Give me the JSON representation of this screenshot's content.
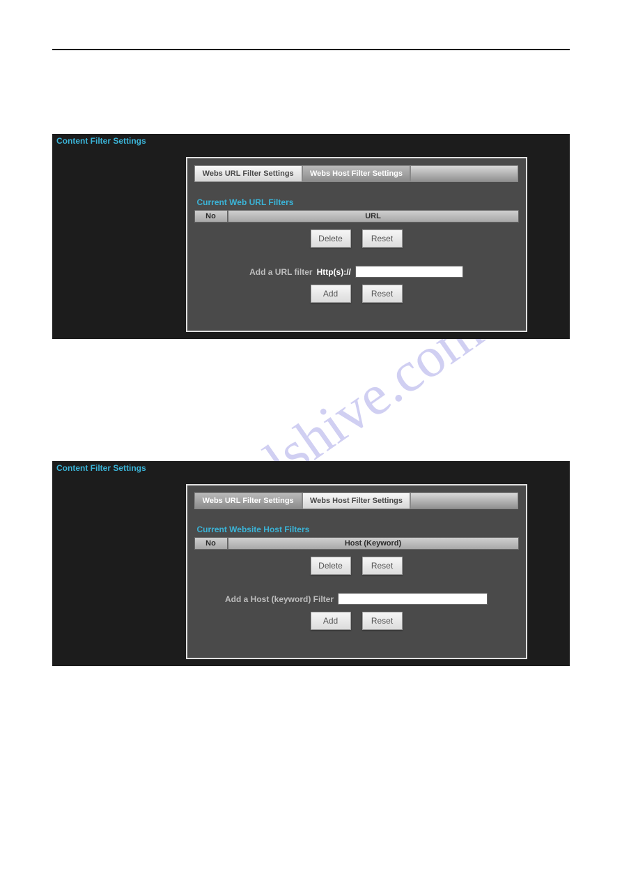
{
  "watermark": "manualshive.com",
  "panel1": {
    "title": "Content Filter Settings",
    "tabs": {
      "active": "Webs URL Filter Settings",
      "inactive": "Webs Host Filter Settings"
    },
    "section_label": "Current Web URL Filters",
    "table": {
      "col_no": "No",
      "col_b": "URL"
    },
    "buttons": {
      "delete": "Delete",
      "reset": "Reset"
    },
    "add_filter": {
      "label": "Add a URL filter",
      "prefix": "Http(s)://",
      "value": ""
    },
    "add_buttons": {
      "add": "Add",
      "reset": "Reset"
    }
  },
  "panel2": {
    "title": "Content Filter Settings",
    "tabs": {
      "inactive": "Webs URL Filter Settings",
      "active": "Webs Host Filter Settings"
    },
    "section_label": "Current Website Host Filters",
    "table": {
      "col_no": "No",
      "col_b": "Host (Keyword)"
    },
    "buttons": {
      "delete": "Delete",
      "reset": "Reset"
    },
    "add_filter": {
      "label": "Add a Host (keyword) Filter",
      "value": ""
    },
    "add_buttons": {
      "add": "Add",
      "reset": "Reset"
    }
  }
}
